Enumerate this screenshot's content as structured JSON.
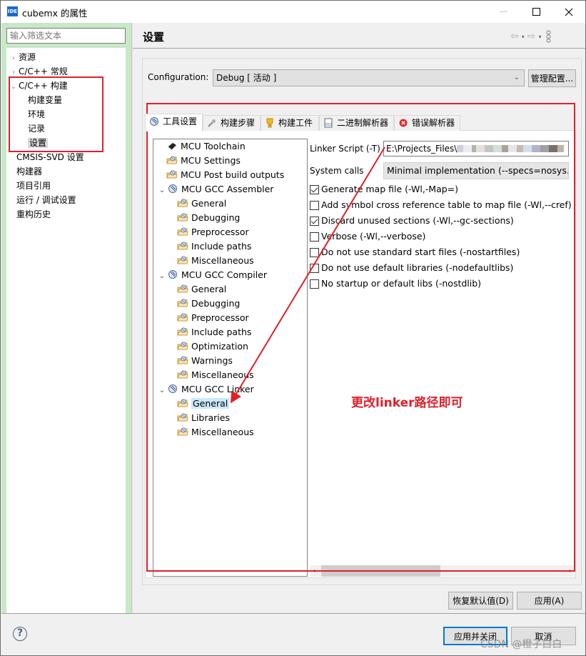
{
  "window": {
    "app_icon": "IDE",
    "title": "cubemx 的属性",
    "controls": {
      "minimize": "—",
      "maximize": "□",
      "close": "✕"
    }
  },
  "sidebar": {
    "filter_placeholder": "输入筛选文本",
    "items": [
      {
        "label": "资源",
        "expander": "›",
        "level": 0
      },
      {
        "label": "C/C++ 常规",
        "expander": "›",
        "level": 0
      },
      {
        "label": "C/C++ 构建",
        "expander": "⌄",
        "level": 0
      },
      {
        "label": "构建变量",
        "level": 1
      },
      {
        "label": "环境",
        "level": 1
      },
      {
        "label": "记录",
        "level": 1
      },
      {
        "label": "设置",
        "level": 1,
        "selected": true
      },
      {
        "label": "CMSIS-SVD 设置",
        "level": 0
      },
      {
        "label": "构建器",
        "level": 0
      },
      {
        "label": "项目引用",
        "level": 0
      },
      {
        "label": "运行 / 调试设置",
        "level": 0
      },
      {
        "label": "重构历史",
        "level": 0
      }
    ]
  },
  "header": {
    "title": "设置",
    "nav": {
      "back": "⇦",
      "forward": "⇨",
      "dropdown": "▾",
      "menu": "⋮"
    }
  },
  "configuration": {
    "label": "Configuration:",
    "value": "Debug  [ 活动 ]",
    "caret": "⌄",
    "manage_button": "管理配置..."
  },
  "tabs": [
    {
      "label": "工具设置",
      "icon": "tool-settings-icon",
      "active": true
    },
    {
      "label": "构建步骤",
      "icon": "build-steps-icon"
    },
    {
      "label": "构建工件",
      "icon": "build-artifact-icon"
    },
    {
      "label": "二进制解析器",
      "icon": "binary-parser-icon"
    },
    {
      "label": "错误解析器",
      "icon": "error-parser-icon"
    }
  ],
  "tool_tree": [
    {
      "label": "MCU Toolchain",
      "icon": "chip",
      "level": 0
    },
    {
      "label": "MCU Settings",
      "icon": "folder",
      "level": 0
    },
    {
      "label": "MCU Post build outputs",
      "icon": "folder",
      "level": 0
    },
    {
      "label": "MCU GCC Assembler",
      "icon": "tool",
      "level": 0,
      "expanded": true
    },
    {
      "label": "General",
      "icon": "folder",
      "level": 1
    },
    {
      "label": "Debugging",
      "icon": "folder",
      "level": 1
    },
    {
      "label": "Preprocessor",
      "icon": "folder",
      "level": 1
    },
    {
      "label": "Include paths",
      "icon": "folder",
      "level": 1
    },
    {
      "label": "Miscellaneous",
      "icon": "folder",
      "level": 1
    },
    {
      "label": "MCU GCC Compiler",
      "icon": "tool",
      "level": 0,
      "expanded": true
    },
    {
      "label": "General",
      "icon": "folder",
      "level": 1
    },
    {
      "label": "Debugging",
      "icon": "folder",
      "level": 1
    },
    {
      "label": "Preprocessor",
      "icon": "folder",
      "level": 1
    },
    {
      "label": "Include paths",
      "icon": "folder",
      "level": 1
    },
    {
      "label": "Optimization",
      "icon": "folder",
      "level": 1
    },
    {
      "label": "Warnings",
      "icon": "folder",
      "level": 1
    },
    {
      "label": "Miscellaneous",
      "icon": "folder",
      "level": 1
    },
    {
      "label": "MCU GCC Linker",
      "icon": "tool",
      "level": 0,
      "expanded": true
    },
    {
      "label": "General",
      "icon": "folder",
      "level": 1,
      "selected": true
    },
    {
      "label": "Libraries",
      "icon": "folder",
      "level": 1
    },
    {
      "label": "Miscellaneous",
      "icon": "folder",
      "level": 1
    }
  ],
  "linker_general": {
    "linker_script_label": "Linker Script (-T)",
    "linker_script_value": "E:\\Projects_Files\\",
    "system_calls_label": "System calls",
    "system_calls_value": "Minimal implementation (--specs=nosys.specs)",
    "options": [
      {
        "label": "Generate map file (-Wl,-Map=)",
        "checked": true
      },
      {
        "label": "Add symbol cross reference table to map file (-Wl,--cref)",
        "checked": false
      },
      {
        "label": "Discard unused sections (-Wl,--gc-sections)",
        "checked": true
      },
      {
        "label": "Verbose (-Wl,--verbose)",
        "checked": false
      },
      {
        "label": "Do not use standard start files (-nostartfiles)",
        "checked": false
      },
      {
        "label": "Do not use default libraries (-nodefaultlibs)",
        "checked": false
      },
      {
        "label": "No startup or default libs (-nostdlib)",
        "checked": false
      }
    ],
    "scroll": {
      "left": "‹",
      "right": "›"
    }
  },
  "footer": {
    "restore_defaults": "恢复默认值(D)",
    "apply": "应用(A)",
    "help": "?",
    "apply_and_close": "应用并关闭",
    "cancel": "取消"
  },
  "annotation": {
    "text": "更改linker路径即可",
    "color": "#e0202a"
  },
  "watermark": "CSDN @橙子白白"
}
